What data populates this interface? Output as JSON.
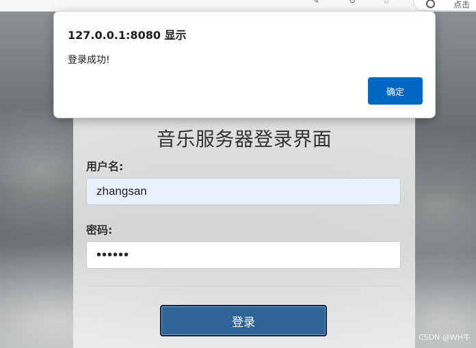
{
  "browser": {
    "address_hint": "点击"
  },
  "dialog": {
    "title": "127.0.0.1:8080 显示",
    "message": "登录成功!",
    "ok_label": "确定",
    "accent": "#0067c0"
  },
  "login": {
    "title": "音乐服务器登录界面",
    "username_label": "用户名:",
    "username_value": "zhangsan",
    "password_label": "密码:",
    "password_value": "••••••",
    "button_label": "登录",
    "button_color": "#2f6497"
  },
  "watermark": "CSDN @WH牛"
}
